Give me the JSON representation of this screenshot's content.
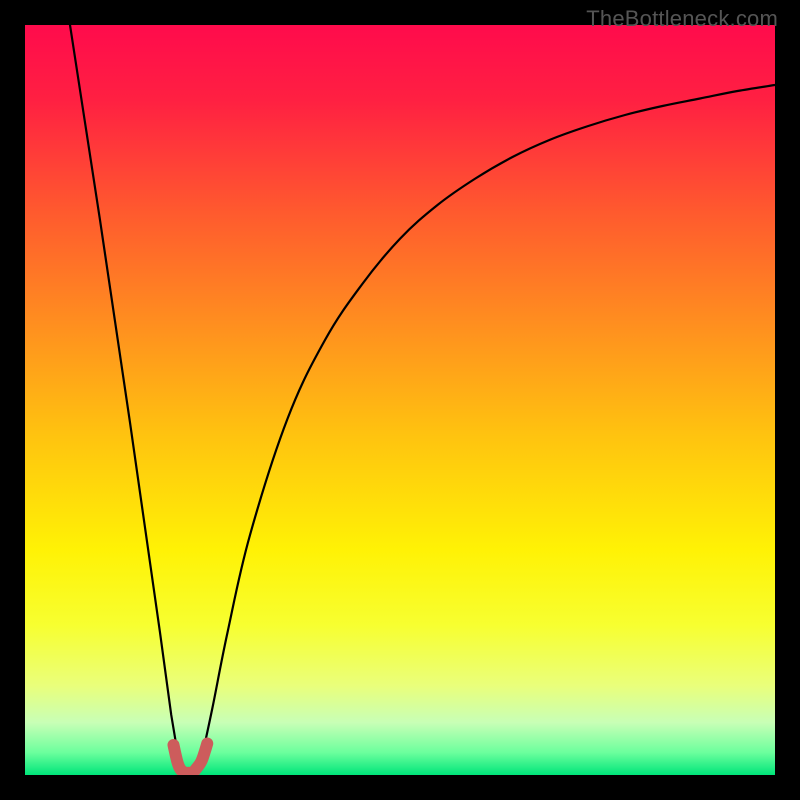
{
  "branding": {
    "watermark": "TheBottleneck.com"
  },
  "colors": {
    "gradient_stops": [
      {
        "offset": 0.0,
        "color": "#ff0b4c"
      },
      {
        "offset": 0.1,
        "color": "#ff2042"
      },
      {
        "offset": 0.25,
        "color": "#ff5a2e"
      },
      {
        "offset": 0.4,
        "color": "#ff8f1f"
      },
      {
        "offset": 0.55,
        "color": "#ffc40f"
      },
      {
        "offset": 0.7,
        "color": "#fff205"
      },
      {
        "offset": 0.8,
        "color": "#f7ff30"
      },
      {
        "offset": 0.88,
        "color": "#eaff7a"
      },
      {
        "offset": 0.93,
        "color": "#c8ffb6"
      },
      {
        "offset": 0.97,
        "color": "#6cff9d"
      },
      {
        "offset": 1.0,
        "color": "#00e57a"
      }
    ],
    "curve": "#000000",
    "marker_fill": "#cd5c5c",
    "marker_stroke": "#b24a4a",
    "frame": "#000000"
  },
  "chart_data": {
    "type": "line",
    "title": "",
    "xlabel": "",
    "ylabel": "",
    "xlim": [
      0,
      100
    ],
    "ylim": [
      0,
      100
    ],
    "grid": false,
    "legend": false,
    "series": [
      {
        "name": "left-branch",
        "x": [
          6.0,
          8.0,
          10.0,
          12.0,
          14.0,
          16.0,
          18.0,
          19.5,
          20.5
        ],
        "y": [
          100.0,
          87.0,
          74.0,
          60.5,
          47.0,
          33.0,
          19.0,
          8.0,
          2.0
        ]
      },
      {
        "name": "right-branch",
        "x": [
          23.5,
          25.0,
          27.0,
          30.0,
          35.0,
          40.0,
          45.0,
          50.0,
          55.0,
          60.0,
          65.0,
          70.0,
          75.0,
          80.0,
          85.0,
          90.0,
          95.0,
          100.0
        ],
        "y": [
          2.0,
          9.0,
          19.0,
          32.0,
          47.5,
          58.0,
          65.5,
          71.5,
          76.0,
          79.5,
          82.4,
          84.7,
          86.5,
          88.0,
          89.2,
          90.2,
          91.2,
          92.0
        ]
      }
    ],
    "marker": {
      "name": "minimum-region",
      "path_x": [
        19.8,
        20.3,
        20.7,
        21.3,
        21.8,
        22.3,
        22.8,
        23.5,
        24.0,
        24.3
      ],
      "path_y": [
        4.0,
        1.8,
        0.8,
        0.3,
        0.3,
        0.3,
        0.8,
        1.8,
        3.2,
        4.2
      ],
      "stroke_width_px": 12
    }
  }
}
